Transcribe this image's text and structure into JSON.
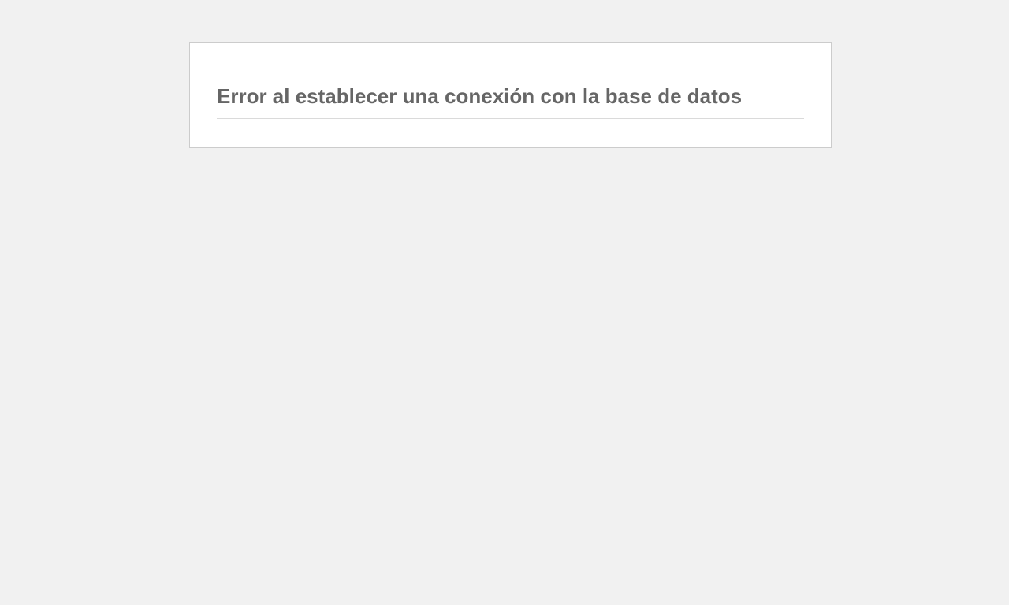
{
  "error": {
    "heading": "Error al establecer una conexión con la base de datos"
  },
  "colors": {
    "page_background": "#f1f1f1",
    "box_background": "#ffffff",
    "box_border": "#cccccc",
    "heading_text": "#666666",
    "divider": "#dadada"
  }
}
